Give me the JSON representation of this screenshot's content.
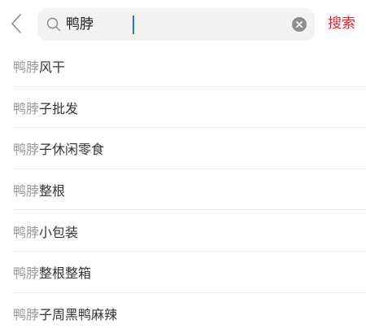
{
  "search": {
    "query": "鸭脖",
    "action_label": "搜索"
  },
  "icons": {
    "back": "chevron-left-icon",
    "search": "search-icon",
    "clear": "clear-icon"
  },
  "colors": {
    "accent": "#e0262a",
    "caret": "#2f6fe0",
    "match_text": "#999999",
    "rest_text": "#333333"
  },
  "suggestions": [
    {
      "match": "鸭脖",
      "rest": "风干"
    },
    {
      "match": "鸭脖",
      "rest": "子批发"
    },
    {
      "match": "鸭脖",
      "rest": "子休闲零食"
    },
    {
      "match": "鸭脖",
      "rest": "整根"
    },
    {
      "match": "鸭脖",
      "rest": "小包装"
    },
    {
      "match": "鸭脖",
      "rest": "整根整箱"
    },
    {
      "match": "鸭脖",
      "rest": "子周黑鸭麻辣"
    }
  ]
}
